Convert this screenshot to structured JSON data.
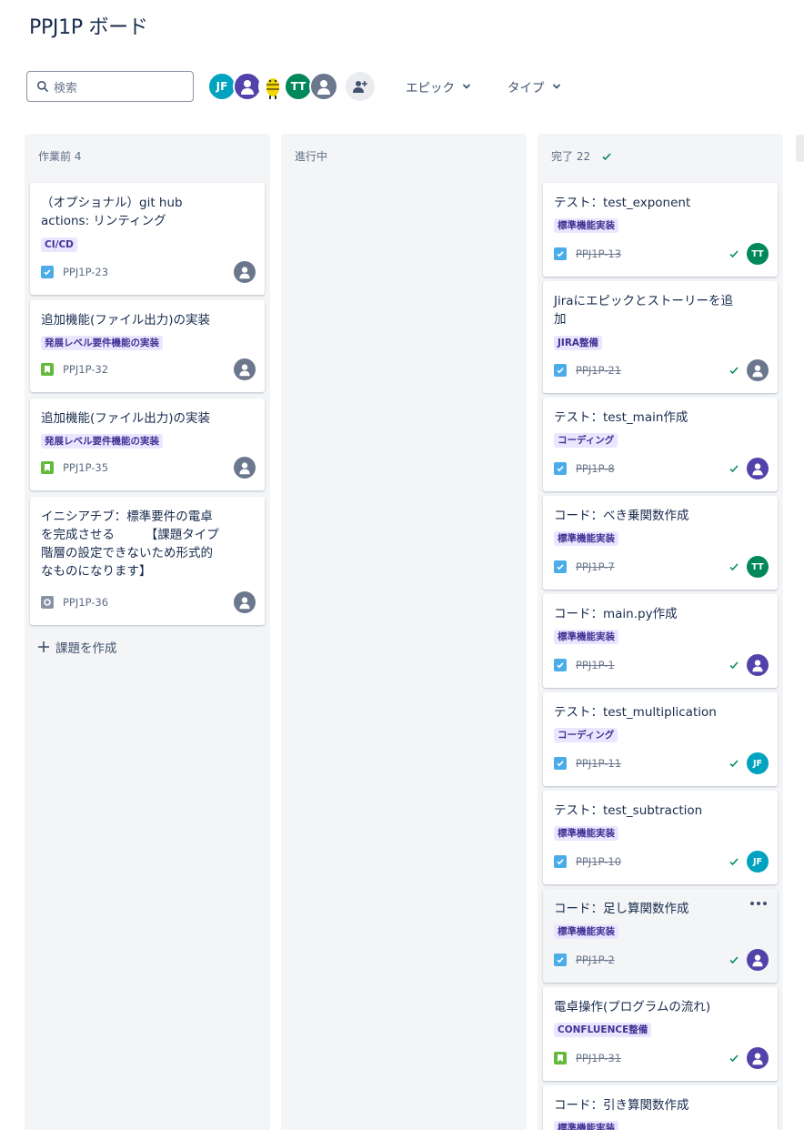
{
  "board_title": "PPJ1P ボード",
  "search": {
    "placeholder": "検索"
  },
  "avatars": [
    {
      "initials": "JF",
      "color": "#00a3bf"
    },
    {
      "initials": "",
      "color": "#5243aa"
    },
    {
      "initials": "",
      "color": "#ffd700"
    },
    {
      "initials": "TT",
      "color": "#00875a"
    },
    {
      "initials": "",
      "color": "#6b778c"
    }
  ],
  "filters": {
    "epic": "エピック",
    "type": "タイプ"
  },
  "columns": [
    {
      "title": "作業前 4",
      "cards": [
        {
          "title": "（オプショナル）git hub actions: リンティング",
          "label": "CI/CD",
          "type": "task",
          "key": "PPJ1P-23",
          "assignee": "gray",
          "initials": ""
        },
        {
          "title": "追加機能(ファイル出力)の実装",
          "label": "発展レベル要件機能の実装",
          "type": "story",
          "key": "PPJ1P-32",
          "assignee": "gray",
          "initials": ""
        },
        {
          "title": "追加機能(ファイル出力)の実装",
          "label": "発展レベル要件機能の実装",
          "type": "story",
          "key": "PPJ1P-35",
          "assignee": "gray",
          "initials": ""
        },
        {
          "title": "イニシアチブ：標準要件の電卓を完成させる　　　【課題タイプ階層の設定できないため形式的なものになります】",
          "label": "",
          "type": "sub",
          "key": "PPJ1P-36",
          "assignee": "gray",
          "initials": ""
        }
      ],
      "create_label": "課題を作成"
    },
    {
      "title": "進行中",
      "cards": []
    },
    {
      "title": "完了 22",
      "cards": [
        {
          "title": "テスト：test_exponent",
          "label": "標準機能実装",
          "type": "task",
          "key": "PPJ1P-13",
          "assignee": "tt",
          "initials": "TT"
        },
        {
          "title": "Jiraにエピックとストーリーを追加",
          "label": "JIRA整備",
          "type": "task",
          "key": "PPJ1P-21",
          "assignee": "gray",
          "initials": ""
        },
        {
          "title": "テスト：test_main作成",
          "label": "コーディング",
          "type": "task",
          "key": "PPJ1P-8",
          "assignee": "purple",
          "initials": ""
        },
        {
          "title": "コード：べき乗関数作成",
          "label": "標準機能実装",
          "type": "task",
          "key": "PPJ1P-7",
          "assignee": "tt",
          "initials": "TT"
        },
        {
          "title": "コード：main.py作成",
          "label": "標準機能実装",
          "type": "task",
          "key": "PPJ1P-1",
          "assignee": "purple",
          "initials": ""
        },
        {
          "title": "テスト：test_multiplication",
          "label": "コーディング",
          "type": "task",
          "key": "PPJ1P-11",
          "assignee": "jf",
          "initials": "JF"
        },
        {
          "title": "テスト：test_subtraction",
          "label": "標準機能実装",
          "type": "task",
          "key": "PPJ1P-10",
          "assignee": "jf",
          "initials": "JF"
        },
        {
          "title": "コード：足し算関数作成",
          "label": "標準機能実装",
          "type": "task",
          "key": "PPJ1P-2",
          "assignee": "purple",
          "initials": ""
        },
        {
          "title": "電卓操作(プログラムの流れ)",
          "label": "CONFLUENCE整備",
          "type": "story",
          "key": "PPJ1P-31",
          "assignee": "purple",
          "initials": ""
        },
        {
          "title": "コード：引き算関数作成",
          "label": "標準機能実装",
          "type": "task",
          "key": "",
          "assignee": "",
          "initials": ""
        }
      ]
    }
  ]
}
